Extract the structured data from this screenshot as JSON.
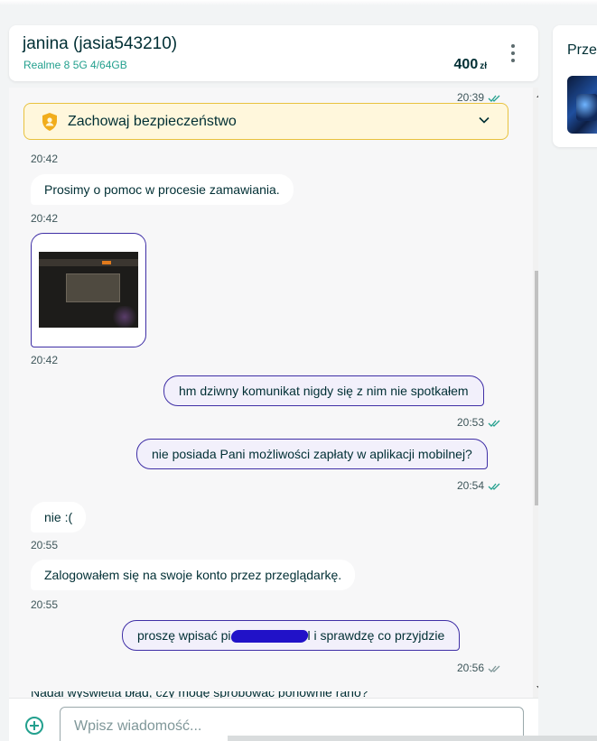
{
  "header": {
    "user_name": "janina (jasia543210)",
    "product": "Realme 8 5G 4/64GB",
    "price": "400",
    "currency": "zł"
  },
  "side_panel": {
    "title": "Prze"
  },
  "safety_banner": {
    "label": "Zachowaj bezpieczeństwo",
    "icon": "shield-user-icon"
  },
  "messages": {
    "top_time": "20:39",
    "t1": "20:42",
    "m1": "Prosimy o pomoc w procesie zamawiania.",
    "t2": "20:42",
    "t3": "20:42",
    "m3": "hm dziwny komunikat nigdy się z nim nie spotkałem",
    "t4": "20:53",
    "m4": "nie posiada Pani możliwości zapłaty w aplikacji mobilnej?",
    "t5": "20:54",
    "m5": "nie :(",
    "t6": "20:55",
    "m6": "Zalogowałem się na swoje konto przez przeglądarkę.",
    "t7": "20:55",
    "m7_start": "proszę wpisać pi",
    "m7_end": "l i sprawdzę co przyjdzie",
    "t8": "20:56",
    "m8_partial": "Nadal wyświetla błąd, czy mogę spróbować ponownie rano?"
  },
  "composer": {
    "placeholder": "Wpisz wiadomość..."
  },
  "colors": {
    "accent": "#23a08e",
    "outgoing_border": "#3f2fa6",
    "banner_bg": "#fff7dc",
    "banner_border": "#e8c23e"
  }
}
